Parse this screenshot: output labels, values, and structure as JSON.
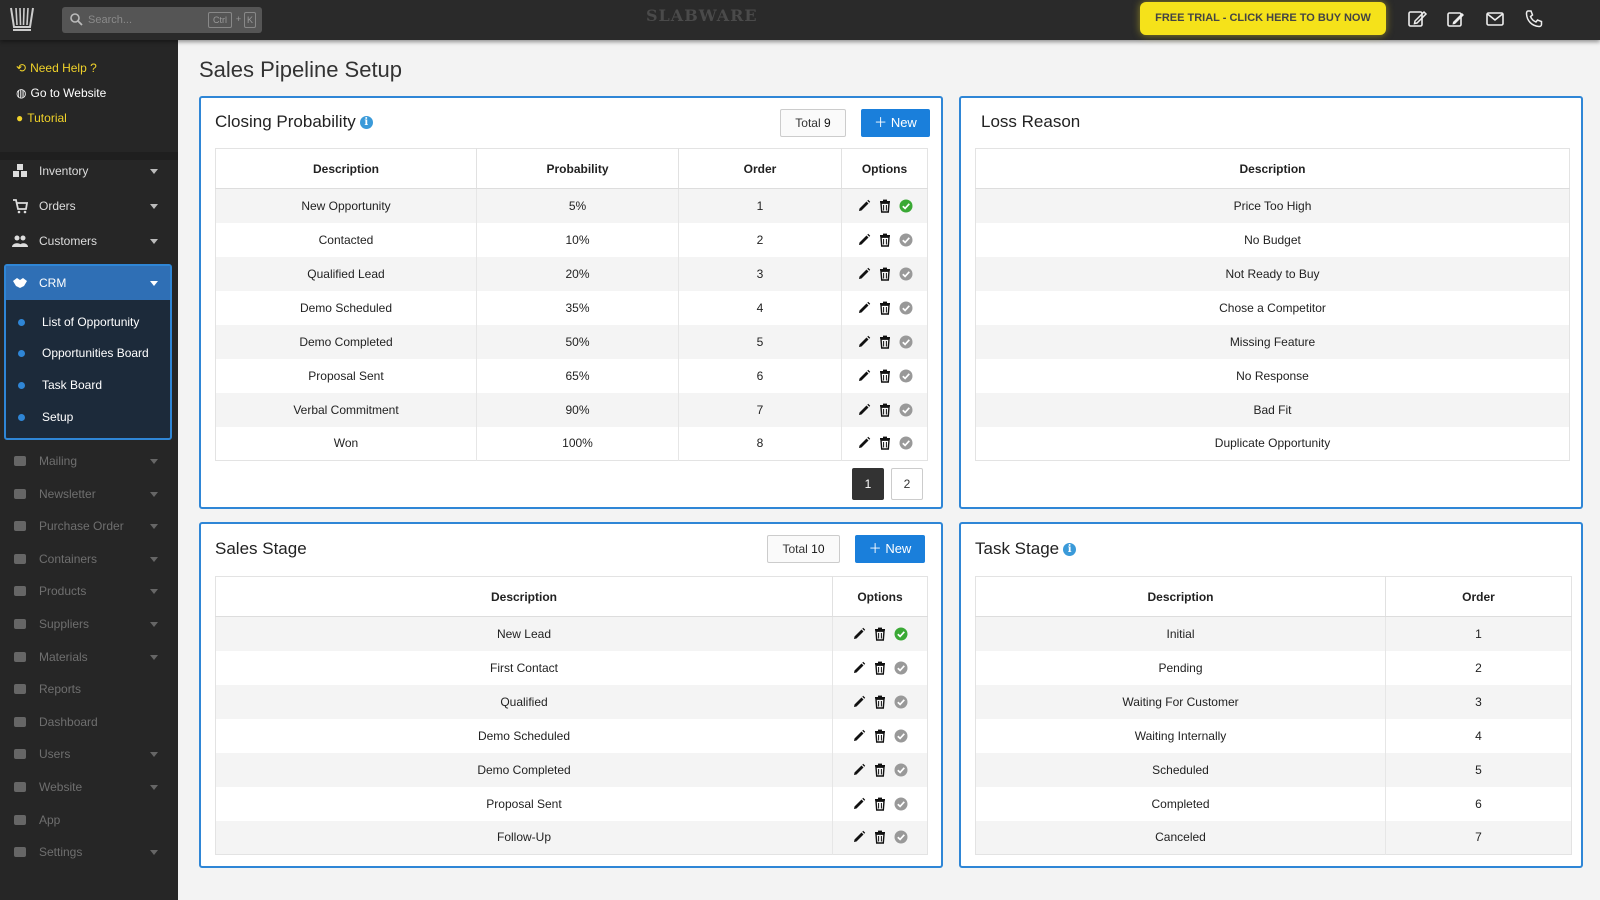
{
  "topbar": {
    "search_placeholder": "Search...",
    "shortcut_ctrl": "Ctrl",
    "shortcut_plus": "+",
    "shortcut_key": "K",
    "brand": "SLABWARE",
    "trial_label": "FREE TRIAL - CLICK HERE TO BUY NOW"
  },
  "sidebar": {
    "help": "Need Help ?",
    "website": "Go to Website",
    "tutorial": "Tutorial",
    "items": [
      {
        "label": "Inventory",
        "icon": "cubes-icon"
      },
      {
        "label": "Orders",
        "icon": "cart-icon"
      },
      {
        "label": "Customers",
        "icon": "users-icon"
      }
    ],
    "crm": {
      "label": "CRM",
      "subitems": [
        "List of Opportunity",
        "Opportunities Board",
        "Task Board",
        "Setup"
      ]
    },
    "dim_items": [
      "Mailing",
      "Newsletter",
      "Purchase Order",
      "Containers",
      "Products",
      "Suppliers",
      "Materials",
      "Reports",
      "Dashboard",
      "Users",
      "Website",
      "App",
      "Settings"
    ]
  },
  "page_title": "Sales Pipeline Setup",
  "closing_probability": {
    "title": "Closing Probability",
    "total_label": "Total",
    "total_value": "9",
    "new_label": "New",
    "columns": [
      "Description",
      "Probability",
      "Order",
      "Options"
    ],
    "rows": [
      [
        "New Opportunity",
        "5%",
        "1"
      ],
      [
        "Contacted",
        "10%",
        "2"
      ],
      [
        "Qualified Lead",
        "20%",
        "3"
      ],
      [
        "Demo Scheduled",
        "35%",
        "4"
      ],
      [
        "Demo Completed",
        "50%",
        "5"
      ],
      [
        "Proposal Sent",
        "65%",
        "6"
      ],
      [
        "Verbal Commitment",
        "90%",
        "7"
      ],
      [
        "Won",
        "100%",
        "8"
      ]
    ],
    "pages": [
      "1",
      "2"
    ]
  },
  "loss_reason": {
    "title": "Loss Reason",
    "columns": [
      "Description"
    ],
    "rows": [
      "Price Too High",
      "No Budget",
      "Not Ready to Buy",
      "Chose a Competitor",
      "Missing Feature",
      "No Response",
      "Bad Fit",
      "Duplicate Opportunity"
    ]
  },
  "sales_stage": {
    "title": "Sales Stage",
    "total_label": "Total",
    "total_value": "10",
    "new_label": "New",
    "columns": [
      "Description",
      "Options"
    ],
    "rows": [
      "New Lead",
      "First Contact",
      "Qualified",
      "Demo Scheduled",
      "Demo Completed",
      "Proposal Sent",
      "Follow-Up"
    ]
  },
  "task_stage": {
    "title": "Task Stage",
    "columns": [
      "Description",
      "Order"
    ],
    "rows": [
      [
        "Initial",
        "1"
      ],
      [
        "Pending",
        "2"
      ],
      [
        "Waiting For Customer",
        "3"
      ],
      [
        "Waiting Internally",
        "4"
      ],
      [
        "Scheduled",
        "5"
      ],
      [
        "Completed",
        "6"
      ],
      [
        "Canceled",
        "7"
      ]
    ]
  },
  "colors": {
    "accent": "#2f86d6",
    "trial_yellow": "#f5e21a",
    "check_active": "#3aa935",
    "check_inactive": "#999999"
  }
}
